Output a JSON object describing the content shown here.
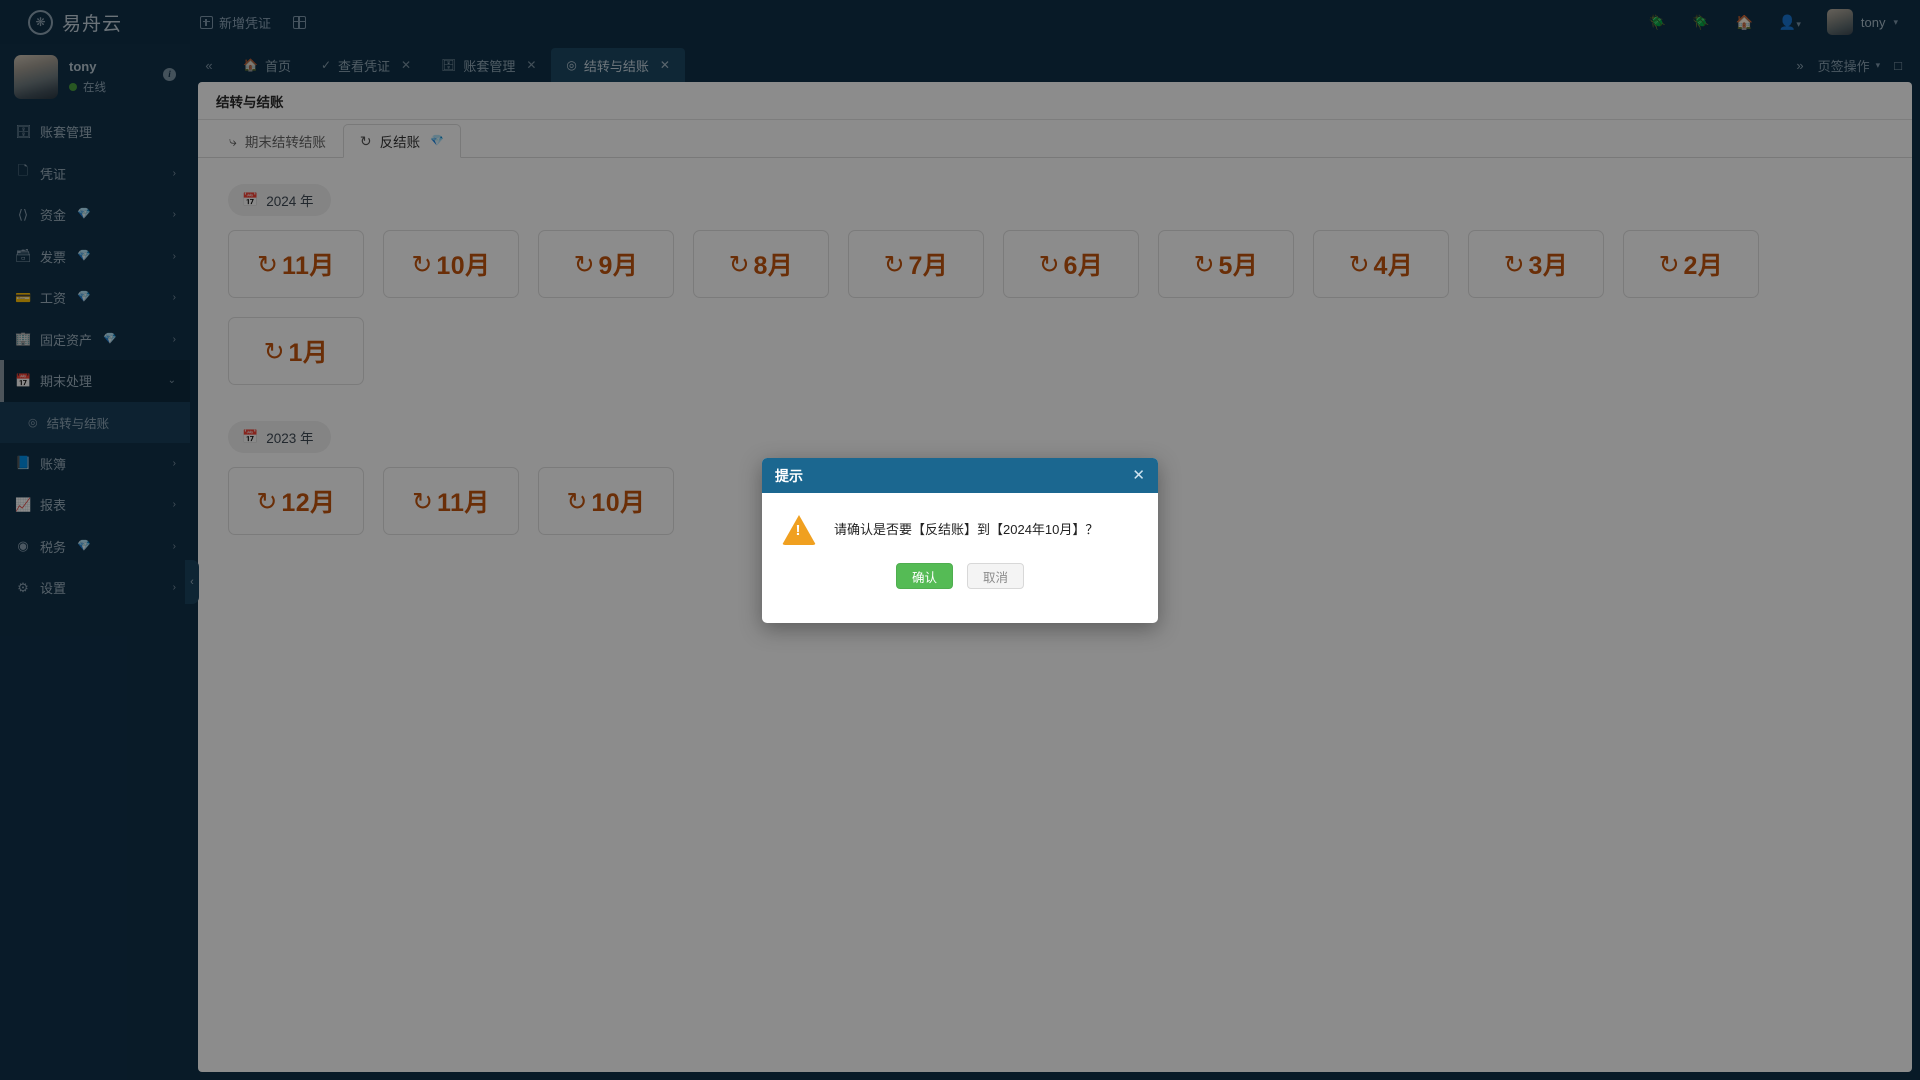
{
  "brand": {
    "name": "易舟云",
    "logo_icon": "seal-logo-icon"
  },
  "topnav": [
    {
      "label": "新增凭证",
      "icon": "plus-square-icon"
    },
    {
      "label": "",
      "icon": "grid-square-icon"
    }
  ],
  "topright": {
    "icons": [
      "bug-icon",
      "bug-icon",
      "home-icon",
      "user-group-icon"
    ],
    "user_name": "tony",
    "caret": "▾"
  },
  "profile": {
    "name": "tony",
    "status": "在线",
    "info_badge": "i"
  },
  "sidebar": {
    "items": [
      {
        "label": "账套管理",
        "icon": "book-stack-icon",
        "gem": false,
        "chevron": ""
      },
      {
        "label": "凭证",
        "icon": "voucher-icon",
        "gem": false,
        "chevron": "›"
      },
      {
        "label": "资金",
        "icon": "funds-icon",
        "gem": true,
        "chevron": "›"
      },
      {
        "label": "发票",
        "icon": "invoice-icon",
        "gem": true,
        "chevron": "›"
      },
      {
        "label": "工资",
        "icon": "salary-card-icon",
        "gem": true,
        "chevron": "›"
      },
      {
        "label": "固定资产",
        "icon": "building-icon",
        "gem": true,
        "chevron": "›"
      },
      {
        "label": "期末处理",
        "icon": "calendar-icon",
        "gem": false,
        "chevron": "⌄",
        "expanded": true
      },
      {
        "label": "账簿",
        "icon": "ledger-icon",
        "gem": false,
        "chevron": "›"
      },
      {
        "label": "报表",
        "icon": "chart-icon",
        "gem": false,
        "chevron": "›"
      },
      {
        "label": "税务",
        "icon": "tax-circle-icon",
        "gem": true,
        "chevron": "›"
      },
      {
        "label": "设置",
        "icon": "gear-icon",
        "gem": false,
        "chevron": "›"
      }
    ],
    "submenu": [
      {
        "label": "结转与结账",
        "icon": "target-circle-icon",
        "active": true
      }
    ],
    "collapse_handle": "‹"
  },
  "tabbar": {
    "scroll_left": "«",
    "scroll_right": "»",
    "tabs": [
      {
        "label": "首页",
        "icon": "home-icon",
        "closable": false,
        "active": false
      },
      {
        "label": "查看凭证",
        "icon": "check-circle-icon",
        "closable": true,
        "active": false
      },
      {
        "label": "账套管理",
        "icon": "book-stack-icon",
        "closable": true,
        "active": false
      },
      {
        "label": "结转与结账",
        "icon": "target-circle-icon",
        "closable": true,
        "active": true
      }
    ],
    "close_glyph": "✕",
    "right_actions": [
      {
        "label": "页签操作",
        "icon": "",
        "caret": "▾"
      },
      {
        "label": "",
        "icon": "expand-icon",
        "caret": ""
      }
    ]
  },
  "page": {
    "title": "结转与结账",
    "inner_tabs": [
      {
        "label": "期末结转结账",
        "icon": "arrow-forward-icon",
        "gem": false,
        "active": false
      },
      {
        "label": "反结账",
        "icon": "undo-icon",
        "gem": true,
        "active": true
      }
    ]
  },
  "sections": [
    {
      "year_label": "2024 年",
      "year_icon": "calendar-icon",
      "months": [
        {
          "label": "11月",
          "icon": "undo-icon"
        },
        {
          "label": "10月",
          "icon": "undo-icon"
        },
        {
          "label": "9月",
          "icon": "undo-icon"
        },
        {
          "label": "8月",
          "icon": "undo-icon"
        },
        {
          "label": "7月",
          "icon": "undo-icon"
        },
        {
          "label": "6月",
          "icon": "undo-icon"
        },
        {
          "label": "5月",
          "icon": "undo-icon"
        },
        {
          "label": "4月",
          "icon": "undo-icon"
        },
        {
          "label": "3月",
          "icon": "undo-icon"
        },
        {
          "label": "2月",
          "icon": "undo-icon"
        },
        {
          "label": "1月",
          "icon": "undo-icon"
        }
      ]
    },
    {
      "year_label": "2023 年",
      "year_icon": "calendar-icon",
      "months": [
        {
          "label": "12月",
          "icon": "undo-icon"
        },
        {
          "label": "11月",
          "icon": "undo-icon"
        },
        {
          "label": "10月",
          "icon": "undo-icon"
        }
      ]
    }
  ],
  "modal": {
    "title": "提示",
    "close": "✕",
    "warn_icon": "warning-triangle-icon",
    "message": "请确认是否要【反结账】到【2024年10月】？",
    "confirm_label": "确认",
    "cancel_label": "取消"
  },
  "colors": {
    "brand_dark": "#103048",
    "sidebar": "#11324a",
    "active_tab": "#1d4763",
    "accent_orange": "#c2540d",
    "modal_header": "#1b6790",
    "confirm_green": "#55bb55",
    "warn_amber": "#f0a020",
    "online_green": "#4a9e3f"
  }
}
